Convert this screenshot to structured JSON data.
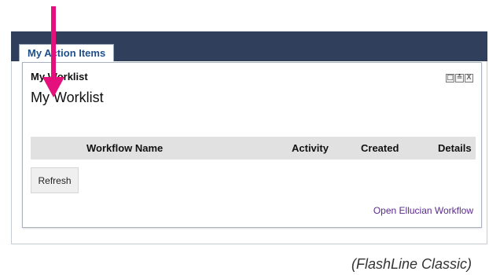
{
  "tabs": {
    "action_items_label": "My Action Items"
  },
  "portlet": {
    "title": "My Worklist",
    "heading": "My Worklist",
    "controls": [
      "□",
      "≛",
      "X"
    ]
  },
  "table": {
    "columns": [
      "Workflow Name",
      "Activity",
      "Created",
      "Details"
    ]
  },
  "buttons": {
    "refresh_label": "Refresh"
  },
  "links": {
    "open_workflow_label": "Open Ellucian Workflow"
  },
  "caption": "(FlashLine Classic)",
  "colors": {
    "topbar": "#2f3f5c",
    "tab_text": "#1f4f8a",
    "arrow": "#e4117c",
    "link": "#5a2a8e",
    "header_bg": "#e1e1e1"
  }
}
